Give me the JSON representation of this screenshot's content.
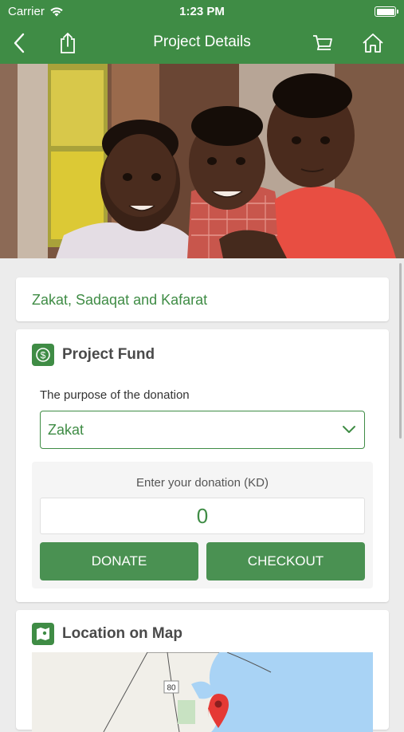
{
  "status_bar": {
    "carrier": "Carrier",
    "time": "1:23 PM"
  },
  "nav": {
    "title": "Project Details"
  },
  "category": {
    "text": "Zakat, Sadaqat and Kafarat"
  },
  "fund": {
    "title": "Project Fund",
    "purpose_label": "The purpose of the donation",
    "purpose_value": "Zakat",
    "donation_label": "Enter your donation (KD)",
    "donation_amount": "0",
    "donate_label": "DONATE",
    "checkout_label": "CHECKOUT"
  },
  "location": {
    "title": "Location on Map",
    "road_marker": "80"
  },
  "colors": {
    "brand_green": "#3f8c45",
    "button_green": "#4a9152",
    "map_water": "#a9d3f5",
    "map_pin": "#e53935"
  },
  "icons": [
    "back-arrow-icon",
    "share-icon",
    "cart-icon",
    "home-icon",
    "dollar-icon",
    "map-icon",
    "chevron-down-icon",
    "map-pin-icon",
    "wifi-icon",
    "battery-icon"
  ]
}
